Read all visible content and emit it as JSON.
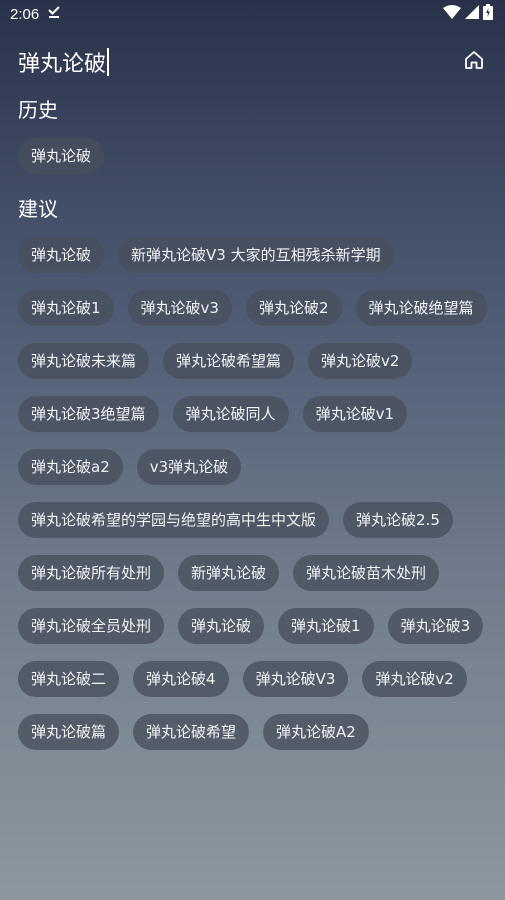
{
  "status_bar": {
    "time": "2:06"
  },
  "search": {
    "query": "弹丸论破"
  },
  "history": {
    "title": "历史",
    "items": [
      "弹丸论破"
    ]
  },
  "suggestions": {
    "title": "建议",
    "items": [
      "弹丸论破",
      "新弹丸论破V3 大家的互相残杀新学期",
      "弹丸论破1",
      "弹丸论破v3",
      "弹丸论破2",
      "弹丸论破绝望篇",
      "弹丸论破未来篇",
      "弹丸论破希望篇",
      "弹丸论破v2",
      "弹丸论破3绝望篇",
      "弹丸论破同人",
      "弹丸论破v1",
      "弹丸论破a2",
      "v3弹丸论破",
      "弹丸论破希望的学园与绝望的高中生中文版",
      "弹丸论破2.5",
      "弹丸论破所有处刑",
      "新弹丸论破",
      "弹丸论破苗木处刑",
      "弹丸论破全员处刑",
      "弹丸论破",
      "弹丸论破1",
      "弹丸论破3",
      "弹丸论破二",
      "弹丸论破4",
      "弹丸论破V3",
      "弹丸论破v2",
      "弹丸论破篇",
      "弹丸论破希望",
      "弹丸论破A2"
    ]
  },
  "icons": {
    "download": "download-done-icon",
    "wifi": "wifi-icon",
    "signal": "cell-signal-icon",
    "battery": "battery-charging-icon",
    "home": "home-icon"
  }
}
